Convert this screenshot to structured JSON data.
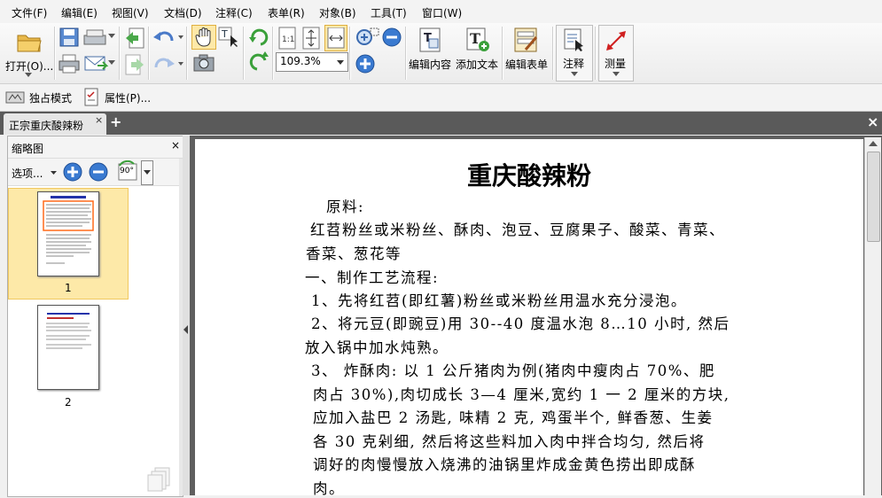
{
  "menu": [
    "文件(F)",
    "编辑(E)",
    "视图(V)",
    "文档(D)",
    "注释(C)",
    "表单(R)",
    "对象(B)",
    "工具(T)",
    "窗口(W)"
  ],
  "toolbar": {
    "open_label": "打开(O)...",
    "zoom_value": "109.3%",
    "edit_content_label": "编辑内容",
    "add_text_label": "添加文本",
    "edit_form_label": "编辑表单",
    "annotate_label": "注释",
    "measure_label": "测量",
    "exclusive_mode_label": "独占模式",
    "properties_label": "属性(P)..."
  },
  "tab": {
    "title": "正宗重庆酸辣粉",
    "close": "×",
    "add": "+"
  },
  "window_close": "×",
  "sidebar": {
    "title": "缩略图",
    "close": "×",
    "options_label": "选项...",
    "rotate_label": "90°",
    "pages": [
      "1",
      "2"
    ]
  },
  "document": {
    "title": "重庆酸辣粉",
    "lines": [
      "原料:",
      "红苕粉丝或米粉丝、酥肉、泡豆、豆腐果子、酸菜、青菜、",
      "香菜、葱花等",
      "一、制作工艺流程:",
      "1、先将红苕(即红薯)粉丝或米粉丝用温水充分浸泡。",
      "2、将元豆(即豌豆)用 30--40 度温水泡 8…10 小时, 然后",
      "放入锅中加水炖熟。",
      "3、 炸酥肉: 以 1 公斤猪肉为例(猪肉中瘦肉占 70%、肥",
      "肉占 30%),肉切成长 3—4 厘米,宽约 1 一 2 厘米的方块,",
      "应加入盐巴 2 汤匙, 味精 2 克, 鸡蛋半个, 鲜香葱、生姜",
      "各 30 克剁细, 然后将这些料加入肉中拌合均匀, 然后将",
      "调好的肉慢慢放入烧沸的油锅里炸成金黄色捞出即成酥",
      "肉。"
    ]
  }
}
